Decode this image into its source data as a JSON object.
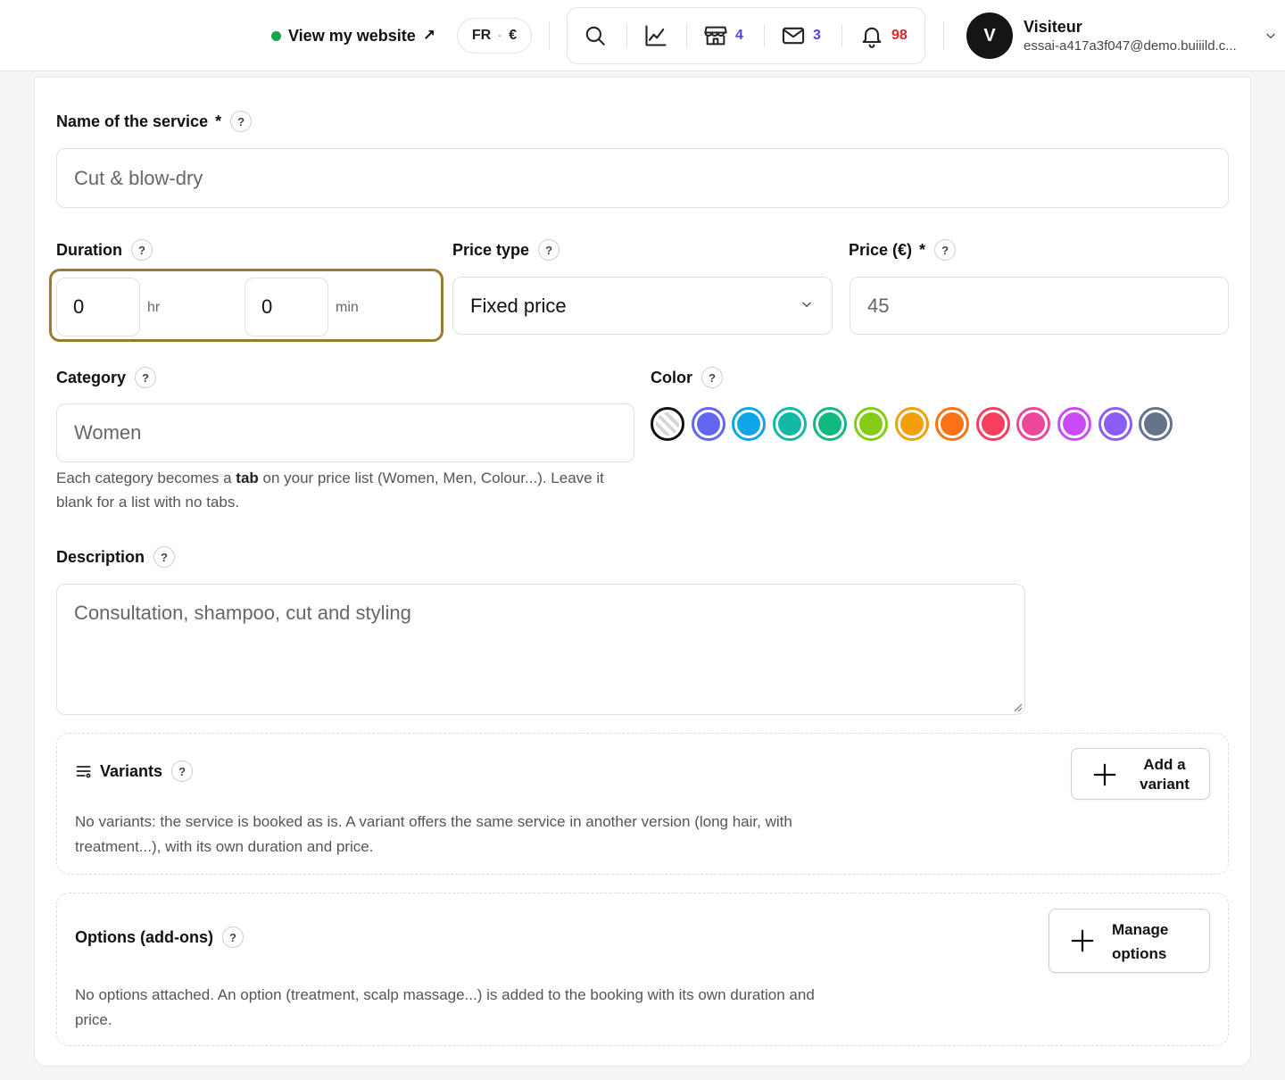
{
  "topbar": {
    "view_site_label": "View my website",
    "view_site_arrow": "↗",
    "lang": "FR",
    "lang_sep": "·",
    "currency": "€",
    "shop_count": "4",
    "mail_count": "3",
    "notif_count": "98",
    "user_initial": "V",
    "user_name": "Visiteur",
    "user_email": "essai-a417a3f047@demo.buiiild.c..."
  },
  "form": {
    "name": {
      "label": "Name of the service",
      "required": "*",
      "help": "?",
      "value": "Cut & blow-dry"
    },
    "duration": {
      "label": "Duration",
      "help": "?",
      "hours": "0",
      "hours_unit": "hr",
      "minutes": "0",
      "minutes_unit": "min"
    },
    "price_type": {
      "label": "Price type",
      "help": "?",
      "value": "Fixed price"
    },
    "price": {
      "label": "Price (€)",
      "required": "*",
      "help": "?",
      "value": "45"
    },
    "category": {
      "label": "Category",
      "help": "?",
      "value": "Women",
      "hint_before": "Each category becomes a ",
      "hint_bold": "tab",
      "hint_after": " on your price list (Women, Men, Colour...). Leave it blank for a list with no tabs."
    },
    "color": {
      "label": "Color",
      "help": "?",
      "swatches": [
        "none",
        "#6366f1",
        "#0ea5e9",
        "#14b8a6",
        "#10b981",
        "#84cc16",
        "#f59e0b",
        "#f97316",
        "#f43f5e",
        "#ec4899",
        "#c84bf5",
        "#8b5cf6",
        "#64748b"
      ],
      "selected": "none"
    },
    "description": {
      "label": "Description",
      "help": "?",
      "value": "Consultation, shampoo, cut and styling"
    },
    "variants": {
      "label": "Variants",
      "help": "?",
      "text": "No variants: the service is booked as is. A variant offers the same service in another version (long hair, with treatment...), with its own duration and price.",
      "button_line1": "Add a",
      "button_line2": "variant"
    },
    "options": {
      "label": "Options (add-ons)",
      "help": "?",
      "text": "No options attached. An option (treatment, scalp massage...) is added to the booking with its own duration and price.",
      "button_line1": "Manage",
      "button_line2": "options"
    }
  },
  "colors": {
    "accent_outline": "#9a7a32",
    "status_online": "#16a34a",
    "count_blue": "#4f46e5",
    "count_red": "#dc2626"
  }
}
